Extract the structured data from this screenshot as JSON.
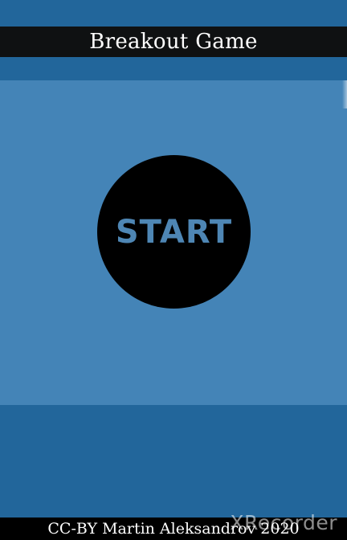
{
  "game": {
    "title": "Breakout Game",
    "start_label": "START",
    "credit": "CC-BY Martin Aleksandrov 2020"
  },
  "overlay": {
    "watermark": "XRecorder"
  },
  "colors": {
    "background": "#22669b",
    "play_area": "#4484b7",
    "title_bar": "#0f1112",
    "start_button": "#000000",
    "start_text": "#4e86b4",
    "footer": "#000000"
  }
}
